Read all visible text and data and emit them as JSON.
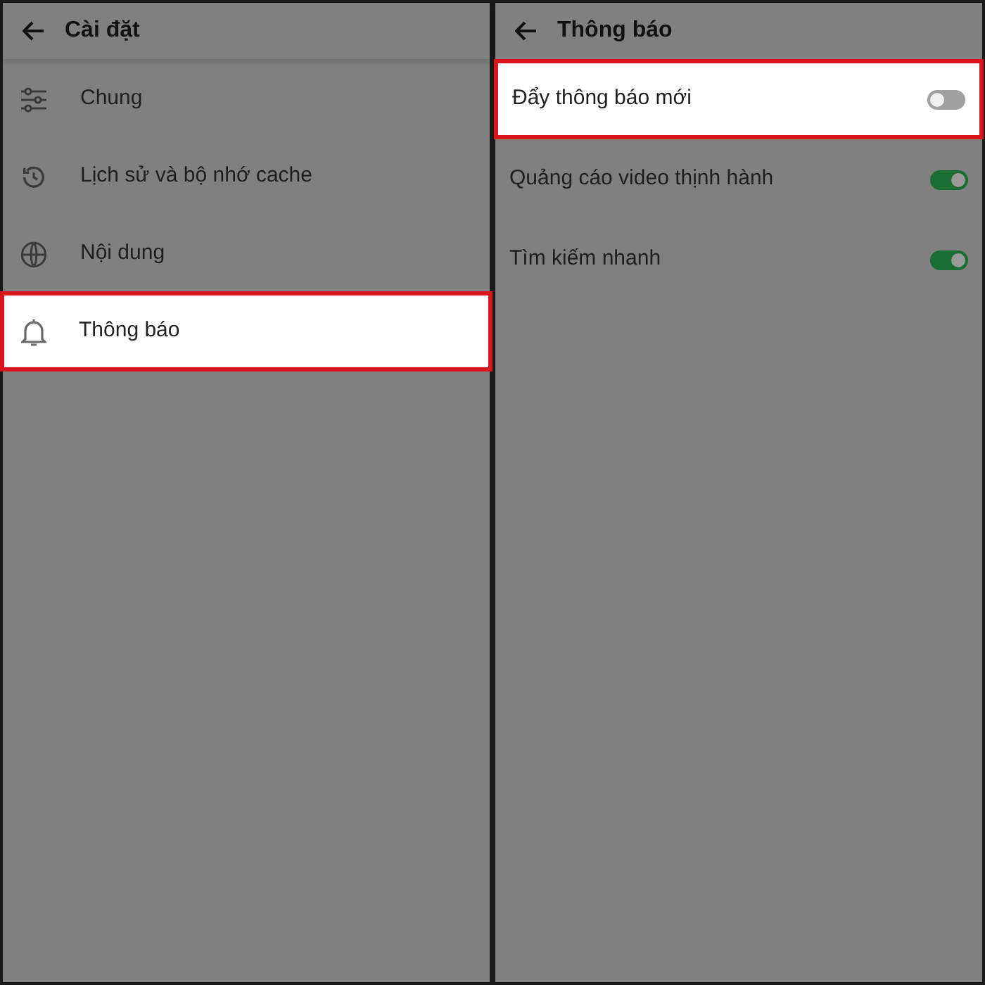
{
  "settings_panel": {
    "title": "Cài đặt",
    "items": [
      {
        "label": "Chung",
        "highlighted": false
      },
      {
        "label": "Lịch sử và bộ nhớ cache",
        "highlighted": false
      },
      {
        "label": "Nội dung",
        "highlighted": false
      },
      {
        "label": "Thông báo",
        "highlighted": true
      }
    ]
  },
  "notifications_panel": {
    "title": "Thông báo",
    "items": [
      {
        "label": "Đẩy thông báo mới",
        "on": false,
        "highlighted": true
      },
      {
        "label": "Quảng cáo video thịnh hành",
        "on": true,
        "highlighted": false
      },
      {
        "label": "Tìm kiếm nhanh",
        "on": true,
        "highlighted": false
      }
    ]
  }
}
